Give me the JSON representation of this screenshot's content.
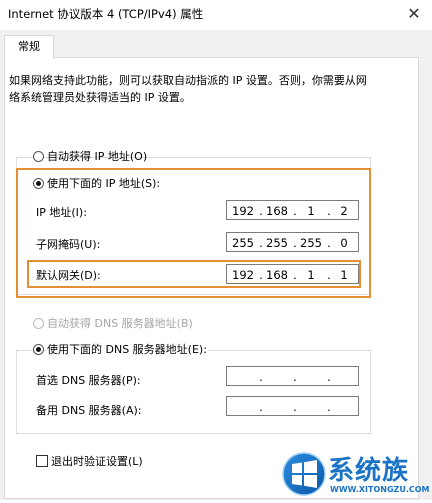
{
  "window": {
    "title": "Internet 协议版本 4 (TCP/IPv4) 属性"
  },
  "tab": {
    "label": "常规"
  },
  "description": [
    "如果网络支持此功能，则可以获取自动指派的 IP 设置。否则，你需要从网",
    "络系统管理员处获得适当的 IP 设置。"
  ],
  "ip": {
    "auto_label": "自动获得 IP 地址(O)",
    "manual_label": "使用下面的 IP 地址(S):",
    "address": {
      "label": "IP 地址(I):",
      "octets": [
        "192",
        "168",
        "1",
        "2"
      ]
    },
    "mask": {
      "label": "子网掩码(U):",
      "octets": [
        "255",
        "255",
        "255",
        "0"
      ]
    },
    "gateway": {
      "label": "默认网关(D):",
      "octets": [
        "192",
        "168",
        "1",
        "1"
      ]
    }
  },
  "dns": {
    "auto_label": "自动获得 DNS 服务器地址(B)",
    "manual_label": "使用下面的 DNS 服务器地址(E):",
    "preferred": {
      "label": "首选 DNS 服务器(P):",
      "octets": [
        "",
        "",
        "",
        ""
      ]
    },
    "alternate": {
      "label": "备用 DNS 服务器(A):",
      "octets": [
        "",
        "",
        "",
        ""
      ]
    }
  },
  "validate": {
    "label": "退出时验证设置(L)"
  },
  "watermark": {
    "brand_cn": "系统族",
    "url": "WWW.XITONGZU.COM"
  },
  "colors": {
    "highlight": "#e58e36",
    "logo_blue": "#1a73c6"
  }
}
